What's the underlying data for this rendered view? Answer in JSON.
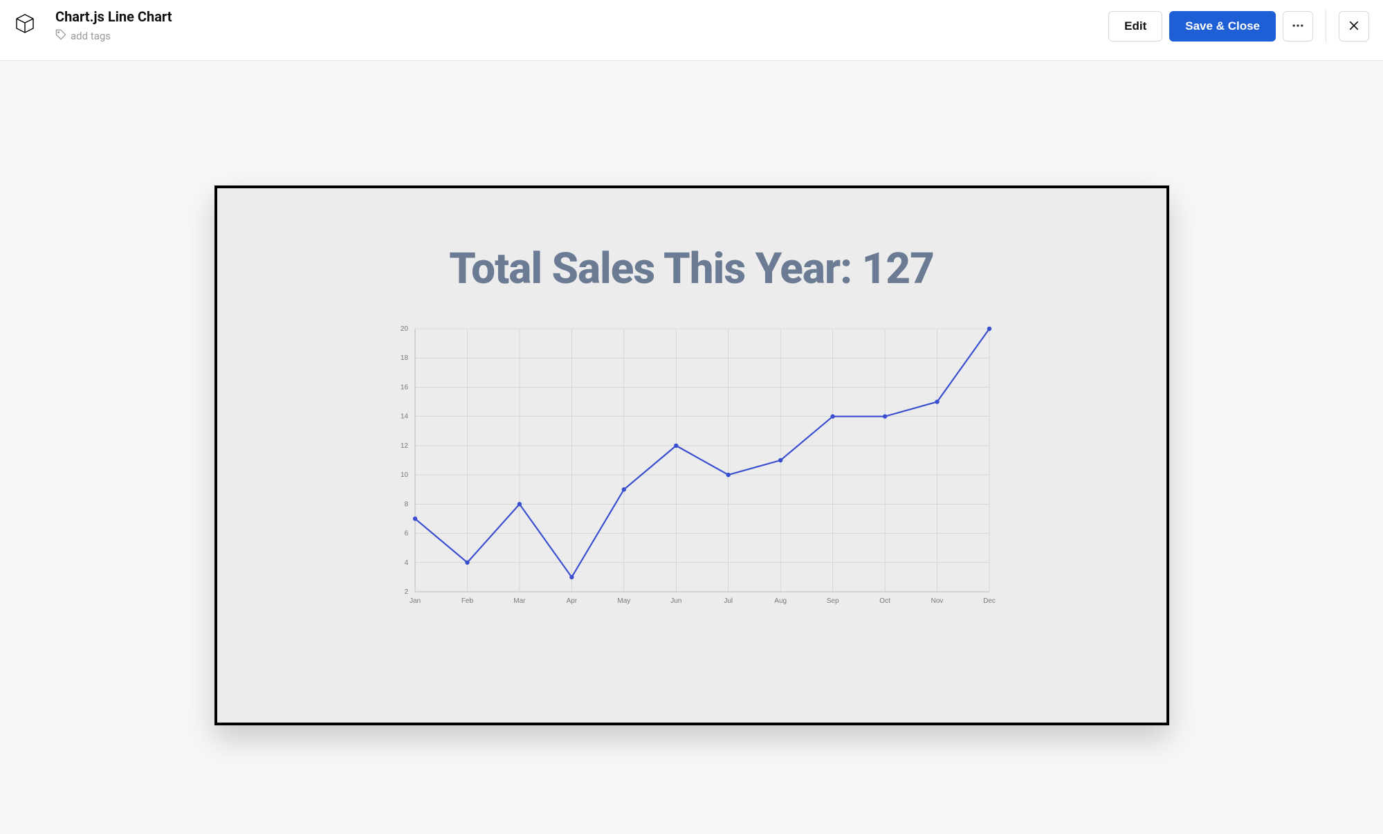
{
  "header": {
    "title": "Chart.js Line Chart",
    "add_tags": "add tags",
    "edit_label": "Edit",
    "save_close_label": "Save & Close"
  },
  "chart_data": {
    "type": "line",
    "title": "Total Sales This Year: 127",
    "categories": [
      "Jan",
      "Feb",
      "Mar",
      "Apr",
      "May",
      "Jun",
      "Jul",
      "Aug",
      "Sep",
      "Oct",
      "Nov",
      "Dec"
    ],
    "values": [
      7,
      4,
      8,
      3,
      9,
      12,
      10,
      11,
      14,
      14,
      15,
      20
    ],
    "xlabel": "",
    "ylabel": "",
    "ylim": [
      2,
      20
    ],
    "yticks": [
      2,
      4,
      6,
      8,
      10,
      12,
      14,
      16,
      18,
      20
    ],
    "line_color": "#3a4fd0",
    "point_color": "#3a4fd0"
  }
}
